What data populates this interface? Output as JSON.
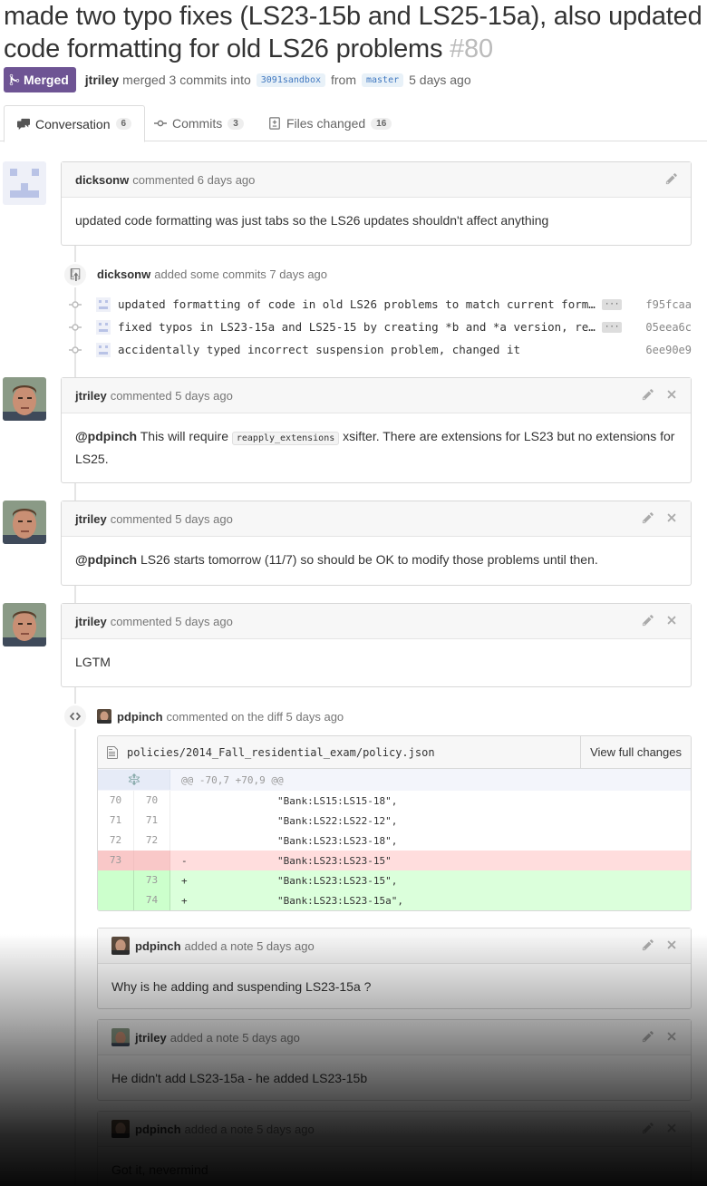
{
  "pr": {
    "title": "made two typo fixes (LS23-15b and LS25-15a), also updated code formatting for old LS26 problems",
    "number": "#80",
    "state_label": "Merged",
    "author": "jtriley",
    "merged_text": "merged 3 commits into",
    "base_branch": "3091sandbox",
    "from_text": "from",
    "head_branch": "master",
    "time": "5 days ago"
  },
  "tabs": [
    {
      "label": "Conversation",
      "count": "6"
    },
    {
      "label": "Commits",
      "count": "3"
    },
    {
      "label": "Files changed",
      "count": "16"
    }
  ],
  "comments": [
    {
      "author": "dicksonw",
      "action": "commented 6 days ago",
      "body": "updated code formatting was just tabs so the LS26 updates shouldn't affect anything"
    },
    {
      "author": "jtriley",
      "action": "commented 5 days ago",
      "mention": "@pdpinch",
      "body_a": "This will require",
      "code": "reapply_extensions",
      "body_b": "xsifter. There are extensions for LS23 but no extensions for LS25."
    },
    {
      "author": "jtriley",
      "action": "commented 5 days ago",
      "mention": "@pdpinch",
      "body": "LS26 starts tomorrow (11/7) so should be OK to modify those problems until then."
    },
    {
      "author": "jtriley",
      "action": "commented 5 days ago",
      "body": "LGTM"
    }
  ],
  "commit_event": {
    "author": "dicksonw",
    "action": "added some commits 7 days ago",
    "commits": [
      {
        "message": "updated formatting of code in old LS26 problems to match current form…",
        "sha": "f95fcaa",
        "more": "···"
      },
      {
        "message": "fixed typos in LS23-15a and LS25-15 by creating *b and *a version, re…",
        "sha": "05eea6c",
        "more": "···"
      },
      {
        "message": "accidentally typed incorrect suspension problem, changed it",
        "sha": "6ee90e9",
        "more": ""
      }
    ]
  },
  "diff_event": {
    "author": "pdpinch",
    "action": "commented on the diff 5 days ago"
  },
  "diff": {
    "path": "policies/2014_Fall_residential_exam/policy.json",
    "view_label": "View full changes",
    "hunk": "@@ -70,7 +70,9 @@",
    "lines": [
      {
        "old": "70",
        "new": "70",
        "code": "                \"Bank:LS15:LS15-18\",",
        "type": "ctx"
      },
      {
        "old": "71",
        "new": "71",
        "code": "                \"Bank:LS22:LS22-12\",",
        "type": "ctx"
      },
      {
        "old": "72",
        "new": "72",
        "code": "                \"Bank:LS23:LS23-18\",",
        "type": "ctx"
      },
      {
        "old": "73",
        "new": "",
        "code": "-               \"Bank:LS23:LS23-15\"",
        "type": "del"
      },
      {
        "old": "",
        "new": "73",
        "code": "+               \"Bank:LS23:LS23-15\",",
        "type": "add"
      },
      {
        "old": "",
        "new": "74",
        "code": "+               \"Bank:LS23:LS23-15a\",",
        "type": "add"
      }
    ]
  },
  "notes": [
    {
      "author": "pdpinch",
      "action": "added a note 5 days ago",
      "body": "Why is he adding and suspending LS23-15a ?"
    },
    {
      "author": "jtriley",
      "action": "added a note 5 days ago",
      "body": "He didn't add LS23-15a - he added LS23-15b"
    },
    {
      "author": "pdpinch",
      "action": "added a note 5 days ago",
      "body": "Got it, nevermind"
    }
  ],
  "colors": {
    "merged": "#6e5494",
    "del": "#ffdddd",
    "add": "#dbffdb",
    "link": "#4078c0"
  }
}
